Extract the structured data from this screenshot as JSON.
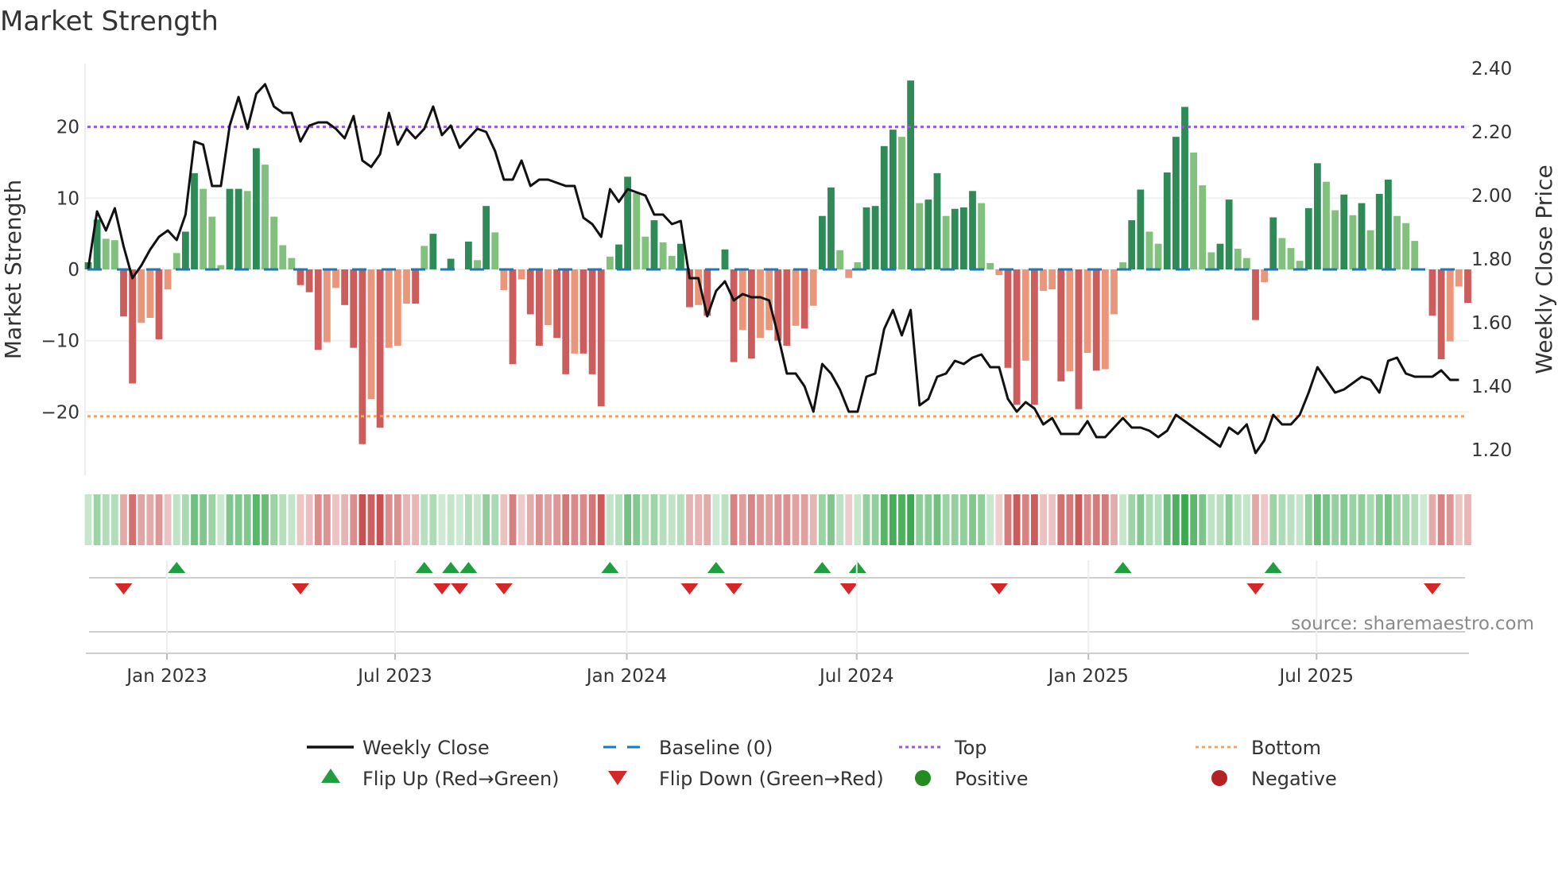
{
  "chart_data": {
    "type": "bar",
    "title": "Market Strength",
    "ylabel": "Market Strength",
    "y2label": "Weekly Close Price",
    "ylim": [
      -29,
      29
    ],
    "y2lim": [
      1.12,
      2.42
    ],
    "yticks": [
      "20",
      "10",
      "0",
      "−10",
      "−20"
    ],
    "ytick_values": [
      20,
      10,
      0,
      -10,
      -20
    ],
    "y2ticks": [
      "2.40",
      "2.20",
      "2.00",
      "1.80",
      "1.60",
      "1.40",
      "1.20"
    ],
    "y2tick_values": [
      2.4,
      2.2,
      2.0,
      1.8,
      1.6,
      1.4,
      1.2
    ],
    "xticks": [
      "Jan 2023",
      "Jul 2023",
      "Jan 2024",
      "Jul 2024",
      "Jan 2025",
      "Jul 2025"
    ],
    "xtick_week_index": [
      8.9,
      34.7,
      60.9,
      86.9,
      113.1,
      138.9
    ],
    "top_level": 20,
    "bottom_level": -20.6,
    "strength": [
      1,
      7,
      4.3,
      4.1,
      -6.6,
      -16,
      -7.5,
      -6.8,
      -9.8,
      -2.8,
      2.3,
      5.3,
      13.5,
      11.3,
      7.4,
      0.6,
      11.3,
      11.3,
      11,
      17,
      14.7,
      7.4,
      3.4,
      1.6,
      -2.2,
      -3.2,
      -11.3,
      -10.2,
      -2.6,
      -5,
      -11,
      -24.5,
      -18.2,
      -22.2,
      -11,
      -10.7,
      -4.8,
      -4.8,
      3.3,
      5,
      0,
      1.5,
      0,
      3.9,
      1.3,
      8.9,
      5.2,
      -2.9,
      -13.3,
      -1.4,
      -6.3,
      -10.7,
      -7.8,
      -9.6,
      -14.7,
      -11.8,
      -11.8,
      -14.7,
      -19.2,
      1.8,
      3.5,
      13,
      10.7,
      4.6,
      6.9,
      3.8,
      1.9,
      3.6,
      -5.3,
      -5,
      -6.5,
      0.1,
      2.8,
      -13,
      -8.5,
      -12.5,
      -9.6,
      -8.5,
      -10,
      -10.7,
      -7.9,
      -8.3,
      -5.1,
      7.5,
      11.5,
      2.7,
      -1.2,
      1,
      8.7,
      8.9,
      17.3,
      19.6,
      18.6,
      26.5,
      9.3,
      9.8,
      13.5,
      7.5,
      8.5,
      8.7,
      11,
      9.3,
      0.9,
      -0.8,
      -13.8,
      -19,
      -12.8,
      -19,
      -3,
      -2.8,
      -15.7,
      -14.3,
      -19.6,
      -11.7,
      -14.2,
      -14,
      -6.3,
      1,
      6.9,
      11.2,
      5.3,
      3.6,
      13.6,
      18.6,
      22.8,
      16.4,
      11.8,
      2.4,
      3.6,
      9.8,
      2.9,
      1.6,
      -7.1,
      -1.8,
      7.3,
      4.4,
      3,
      1.2,
      8.6,
      14.9,
      12.3,
      8.3,
      10.5,
      7.6,
      9.3,
      5.5,
      10.6,
      12.6,
      7.5,
      6.5,
      4,
      0,
      -6.5,
      -12.6,
      -10.1,
      -2.4,
      -4.7
    ],
    "weekly_close": [
      1.77,
      1.95,
      1.89,
      1.96,
      1.84,
      1.74,
      1.78,
      1.83,
      1.87,
      1.89,
      1.86,
      1.94,
      2.17,
      2.16,
      2.03,
      2.03,
      2.22,
      2.31,
      2.21,
      2.32,
      2.35,
      2.28,
      2.26,
      2.26,
      2.17,
      2.22,
      2.23,
      2.23,
      2.21,
      2.18,
      2.25,
      2.11,
      2.09,
      2.13,
      2.26,
      2.16,
      2.21,
      2.18,
      2.21,
      2.28,
      2.19,
      2.22,
      2.15,
      2.18,
      2.21,
      2.2,
      2.14,
      2.05,
      2.05,
      2.11,
      2.03,
      2.05,
      2.05,
      2.04,
      2.03,
      2.03,
      1.93,
      1.91,
      1.87,
      2.02,
      1.98,
      2.02,
      2.01,
      2.0,
      1.94,
      1.94,
      1.91,
      1.92,
      1.74,
      1.74,
      1.62,
      1.7,
      1.73,
      1.67,
      1.69,
      1.68,
      1.68,
      1.67,
      1.56,
      1.44,
      1.44,
      1.4,
      1.32,
      1.47,
      1.44,
      1.39,
      1.32,
      1.32,
      1.43,
      1.44,
      1.58,
      1.64,
      1.56,
      1.64,
      1.34,
      1.36,
      1.43,
      1.44,
      1.48,
      1.47,
      1.49,
      1.5,
      1.46,
      1.46,
      1.36,
      1.32,
      1.35,
      1.33,
      1.28,
      1.3,
      1.25,
      1.25,
      1.25,
      1.29,
      1.24,
      1.24,
      1.27,
      1.3,
      1.27,
      1.27,
      1.26,
      1.24,
      1.26,
      1.31,
      1.29,
      1.27,
      1.25,
      1.23,
      1.21,
      1.27,
      1.25,
      1.28,
      1.19,
      1.23,
      1.31,
      1.28,
      1.28,
      1.31,
      1.38,
      1.46,
      1.42,
      1.38,
      1.39,
      1.41,
      1.43,
      1.42,
      1.38,
      1.48,
      1.49,
      1.44,
      1.43,
      1.43,
      1.43,
      1.45,
      1.42,
      1.42
    ],
    "flip_up_week_index": [
      10,
      38,
      41,
      43,
      59,
      71,
      83,
      87,
      117,
      134
    ],
    "flip_down_week_index": [
      4,
      24,
      40,
      42,
      47,
      68,
      73,
      86,
      103,
      132,
      152
    ],
    "legend": {
      "weekly_close": "Weekly Close",
      "baseline": "Baseline (0)",
      "top": "Top",
      "bottom": "Bottom",
      "flip_up": "Flip Up (Red→Green)",
      "flip_down": "Flip Down (Green→Red)",
      "positive": "Positive",
      "negative": "Negative"
    },
    "source": "source: sharemaestro.com",
    "colors": {
      "pos_dark": "#2e8b57",
      "pos_light": "#82c07e",
      "neg_dark": "#cd5c5c",
      "neg_light": "#e9967a",
      "line": "#111111",
      "baseline": "#1f77b4",
      "top": "#9b59d9",
      "bottom": "#f4a460",
      "flip_up": "#1e9e3e",
      "flip_down": "#d62728",
      "positive": "#228b22",
      "negative": "#b22222"
    }
  }
}
